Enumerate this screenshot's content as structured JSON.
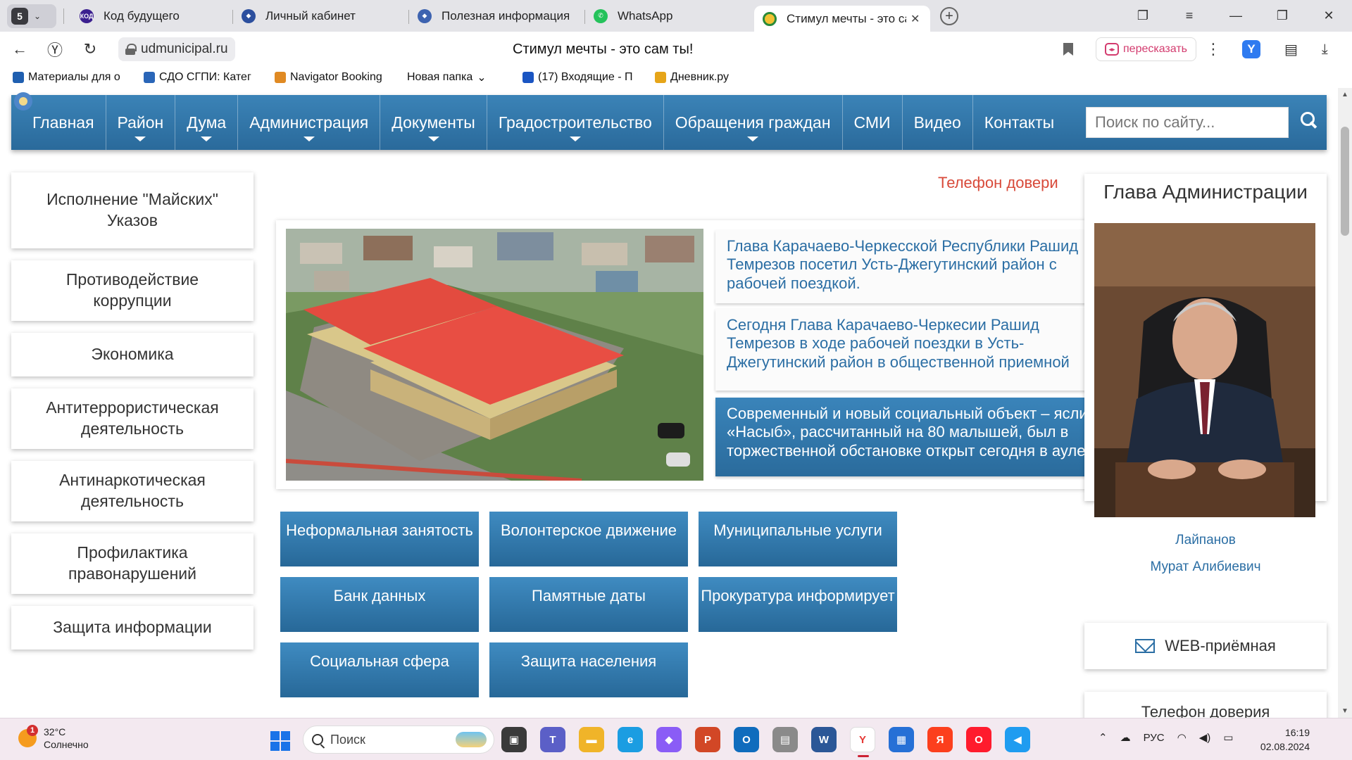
{
  "browser": {
    "tab_count": "5",
    "tabs": [
      {
        "label": "Код будущего",
        "icon": "kod-logo-icon"
      },
      {
        "label": "Личный кабинет",
        "icon": "emblem-icon"
      },
      {
        "label": "Полезная информация",
        "icon": "emblem-icon"
      },
      {
        "label": "WhatsApp",
        "icon": "whatsapp-icon"
      },
      {
        "label": "Стимул мечты - это сам ты!",
        "icon": "site-favicon-icon",
        "active": true
      }
    ],
    "url": "udmunicipal.ru",
    "page_title": "Стимул мечты - это сам ты!",
    "retell_label": "пересказать",
    "bookmarks": [
      {
        "label": "Материалы для о",
        "color": "#1f5fb0"
      },
      {
        "label": "СДО СГПИ: Катег",
        "color": "#2a66b8"
      },
      {
        "label": "Navigator Booking",
        "color": "#e08a23"
      },
      {
        "label": "Новая папка",
        "color": "none"
      },
      {
        "label": "(17) Входящие - П",
        "color": "#1a55c2"
      },
      {
        "label": "Дневник.ру",
        "color": "#e6a519"
      }
    ]
  },
  "site": {
    "nav": [
      {
        "label": "Главная",
        "sub": false
      },
      {
        "label": "Район",
        "sub": true
      },
      {
        "label": "Дума",
        "sub": true
      },
      {
        "label": "Администрация",
        "sub": true
      },
      {
        "label": "Документы",
        "sub": true
      },
      {
        "label": "Градостроительство",
        "sub": true
      },
      {
        "label": "Обращения граждан",
        "sub": true
      },
      {
        "label": "СМИ",
        "sub": false
      },
      {
        "label": "Видео",
        "sub": false
      },
      {
        "label": "Контакты",
        "sub": false
      }
    ],
    "search_placeholder": "Поиск по сайту...",
    "sidebar": [
      "Исполнение \"Майских\" Указов",
      "Противодействие коррупции",
      "Экономика",
      "Антитеррористическая деятельность",
      "Антинаркотическая деятельность",
      "Профилактика правонарушений",
      "Защита информации"
    ],
    "hotline_link": "Телефон довери",
    "slider": {
      "items": [
        "Глава Карачаево-Черкесской Республики Рашид Темрезов посетил Усть-Джегутинский район с рабочей поездкой.",
        "Сегодня Глава Карачаево-Черкесии Рашид Темрезов в ходе рабочей поездки в Усть-Джегутинский район в общественной приемной",
        "Современный и новый социальный объект – ясли «Насыб», рассчитанный на 80 малышей, был в торжественной обстановке открыт сегодня в ауле"
      ],
      "active_index": 2
    },
    "tiles": [
      "Неформальная занятость",
      "Волонтерское движение",
      "Муниципальные услуги",
      "Банк данных",
      "Памятные даты",
      "Прокуратура информирует",
      "Социальная сфера",
      "Защита населения"
    ],
    "head": {
      "title": "Глава Администрации",
      "surname": "Лайпанов",
      "name": "Мурат Алибиевич"
    },
    "web_reception": "WEB-приёмная",
    "hotline_panel": "Телефон доверия"
  },
  "taskbar": {
    "weather_temp": "32°C",
    "weather_desc": "Солнечно",
    "weather_badge": "1",
    "search_placeholder": "Поиск",
    "apps": [
      {
        "name": "task-view-icon",
        "color": "#3a3a3a",
        "glyph": "▣"
      },
      {
        "name": "teams-icon",
        "color": "#5b5fc7",
        "glyph": "T"
      },
      {
        "name": "file-explorer-icon",
        "color": "#f0b429",
        "glyph": "▬"
      },
      {
        "name": "edge-icon",
        "color": "#1b9de2",
        "glyph": "e"
      },
      {
        "name": "copilot-icon",
        "color": "#8a5cf6",
        "glyph": "◆"
      },
      {
        "name": "powerpoint-icon",
        "color": "#d24726",
        "glyph": "P"
      },
      {
        "name": "outlook-icon",
        "color": "#0f6cbd",
        "glyph": "O"
      },
      {
        "name": "scanner-icon",
        "color": "#8a8a8a",
        "glyph": "▤"
      },
      {
        "name": "word-icon",
        "color": "#2b5797",
        "glyph": "W"
      },
      {
        "name": "yandex-browser-icon",
        "color": "#ffffff",
        "glyph": "Y",
        "active": true
      },
      {
        "name": "store-icon",
        "color": "#2670d6",
        "glyph": "▦"
      },
      {
        "name": "yandex-icon",
        "color": "#fc3f1d",
        "glyph": "Я"
      },
      {
        "name": "opera-icon",
        "color": "#ff1b2d",
        "glyph": "O"
      },
      {
        "name": "vscode-icon",
        "color": "#1f9cf0",
        "glyph": "◀"
      }
    ],
    "lang": "РУС",
    "time": "16:19",
    "date": "02.08.2024"
  }
}
